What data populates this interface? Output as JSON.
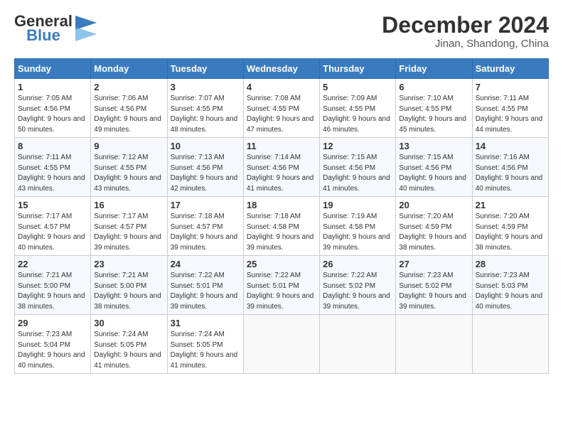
{
  "header": {
    "logo_line1": "General",
    "logo_line2": "Blue",
    "month_title": "December 2024",
    "location": "Jinan, Shandong, China"
  },
  "days_of_week": [
    "Sunday",
    "Monday",
    "Tuesday",
    "Wednesday",
    "Thursday",
    "Friday",
    "Saturday"
  ],
  "weeks": [
    [
      {
        "day": "1",
        "sunrise": "7:05 AM",
        "sunset": "4:56 PM",
        "daylight": "9 hours and 50 minutes."
      },
      {
        "day": "2",
        "sunrise": "7:06 AM",
        "sunset": "4:56 PM",
        "daylight": "9 hours and 49 minutes."
      },
      {
        "day": "3",
        "sunrise": "7:07 AM",
        "sunset": "4:55 PM",
        "daylight": "9 hours and 48 minutes."
      },
      {
        "day": "4",
        "sunrise": "7:08 AM",
        "sunset": "4:55 PM",
        "daylight": "9 hours and 47 minutes."
      },
      {
        "day": "5",
        "sunrise": "7:09 AM",
        "sunset": "4:55 PM",
        "daylight": "9 hours and 46 minutes."
      },
      {
        "day": "6",
        "sunrise": "7:10 AM",
        "sunset": "4:55 PM",
        "daylight": "9 hours and 45 minutes."
      },
      {
        "day": "7",
        "sunrise": "7:11 AM",
        "sunset": "4:55 PM",
        "daylight": "9 hours and 44 minutes."
      }
    ],
    [
      {
        "day": "8",
        "sunrise": "7:11 AM",
        "sunset": "4:55 PM",
        "daylight": "9 hours and 43 minutes."
      },
      {
        "day": "9",
        "sunrise": "7:12 AM",
        "sunset": "4:55 PM",
        "daylight": "9 hours and 43 minutes."
      },
      {
        "day": "10",
        "sunrise": "7:13 AM",
        "sunset": "4:56 PM",
        "daylight": "9 hours and 42 minutes."
      },
      {
        "day": "11",
        "sunrise": "7:14 AM",
        "sunset": "4:56 PM",
        "daylight": "9 hours and 41 minutes."
      },
      {
        "day": "12",
        "sunrise": "7:15 AM",
        "sunset": "4:56 PM",
        "daylight": "9 hours and 41 minutes."
      },
      {
        "day": "13",
        "sunrise": "7:15 AM",
        "sunset": "4:56 PM",
        "daylight": "9 hours and 40 minutes."
      },
      {
        "day": "14",
        "sunrise": "7:16 AM",
        "sunset": "4:56 PM",
        "daylight": "9 hours and 40 minutes."
      }
    ],
    [
      {
        "day": "15",
        "sunrise": "7:17 AM",
        "sunset": "4:57 PM",
        "daylight": "9 hours and 40 minutes."
      },
      {
        "day": "16",
        "sunrise": "7:17 AM",
        "sunset": "4:57 PM",
        "daylight": "9 hours and 39 minutes."
      },
      {
        "day": "17",
        "sunrise": "7:18 AM",
        "sunset": "4:57 PM",
        "daylight": "9 hours and 39 minutes."
      },
      {
        "day": "18",
        "sunrise": "7:18 AM",
        "sunset": "4:58 PM",
        "daylight": "9 hours and 39 minutes."
      },
      {
        "day": "19",
        "sunrise": "7:19 AM",
        "sunset": "4:58 PM",
        "daylight": "9 hours and 39 minutes."
      },
      {
        "day": "20",
        "sunrise": "7:20 AM",
        "sunset": "4:59 PM",
        "daylight": "9 hours and 38 minutes."
      },
      {
        "day": "21",
        "sunrise": "7:20 AM",
        "sunset": "4:59 PM",
        "daylight": "9 hours and 38 minutes."
      }
    ],
    [
      {
        "day": "22",
        "sunrise": "7:21 AM",
        "sunset": "5:00 PM",
        "daylight": "9 hours and 38 minutes."
      },
      {
        "day": "23",
        "sunrise": "7:21 AM",
        "sunset": "5:00 PM",
        "daylight": "9 hours and 38 minutes."
      },
      {
        "day": "24",
        "sunrise": "7:22 AM",
        "sunset": "5:01 PM",
        "daylight": "9 hours and 39 minutes."
      },
      {
        "day": "25",
        "sunrise": "7:22 AM",
        "sunset": "5:01 PM",
        "daylight": "9 hours and 39 minutes."
      },
      {
        "day": "26",
        "sunrise": "7:22 AM",
        "sunset": "5:02 PM",
        "daylight": "9 hours and 39 minutes."
      },
      {
        "day": "27",
        "sunrise": "7:23 AM",
        "sunset": "5:02 PM",
        "daylight": "9 hours and 39 minutes."
      },
      {
        "day": "28",
        "sunrise": "7:23 AM",
        "sunset": "5:03 PM",
        "daylight": "9 hours and 40 minutes."
      }
    ],
    [
      {
        "day": "29",
        "sunrise": "7:23 AM",
        "sunset": "5:04 PM",
        "daylight": "9 hours and 40 minutes."
      },
      {
        "day": "30",
        "sunrise": "7:24 AM",
        "sunset": "5:05 PM",
        "daylight": "9 hours and 41 minutes."
      },
      {
        "day": "31",
        "sunrise": "7:24 AM",
        "sunset": "5:05 PM",
        "daylight": "9 hours and 41 minutes."
      },
      null,
      null,
      null,
      null
    ]
  ]
}
